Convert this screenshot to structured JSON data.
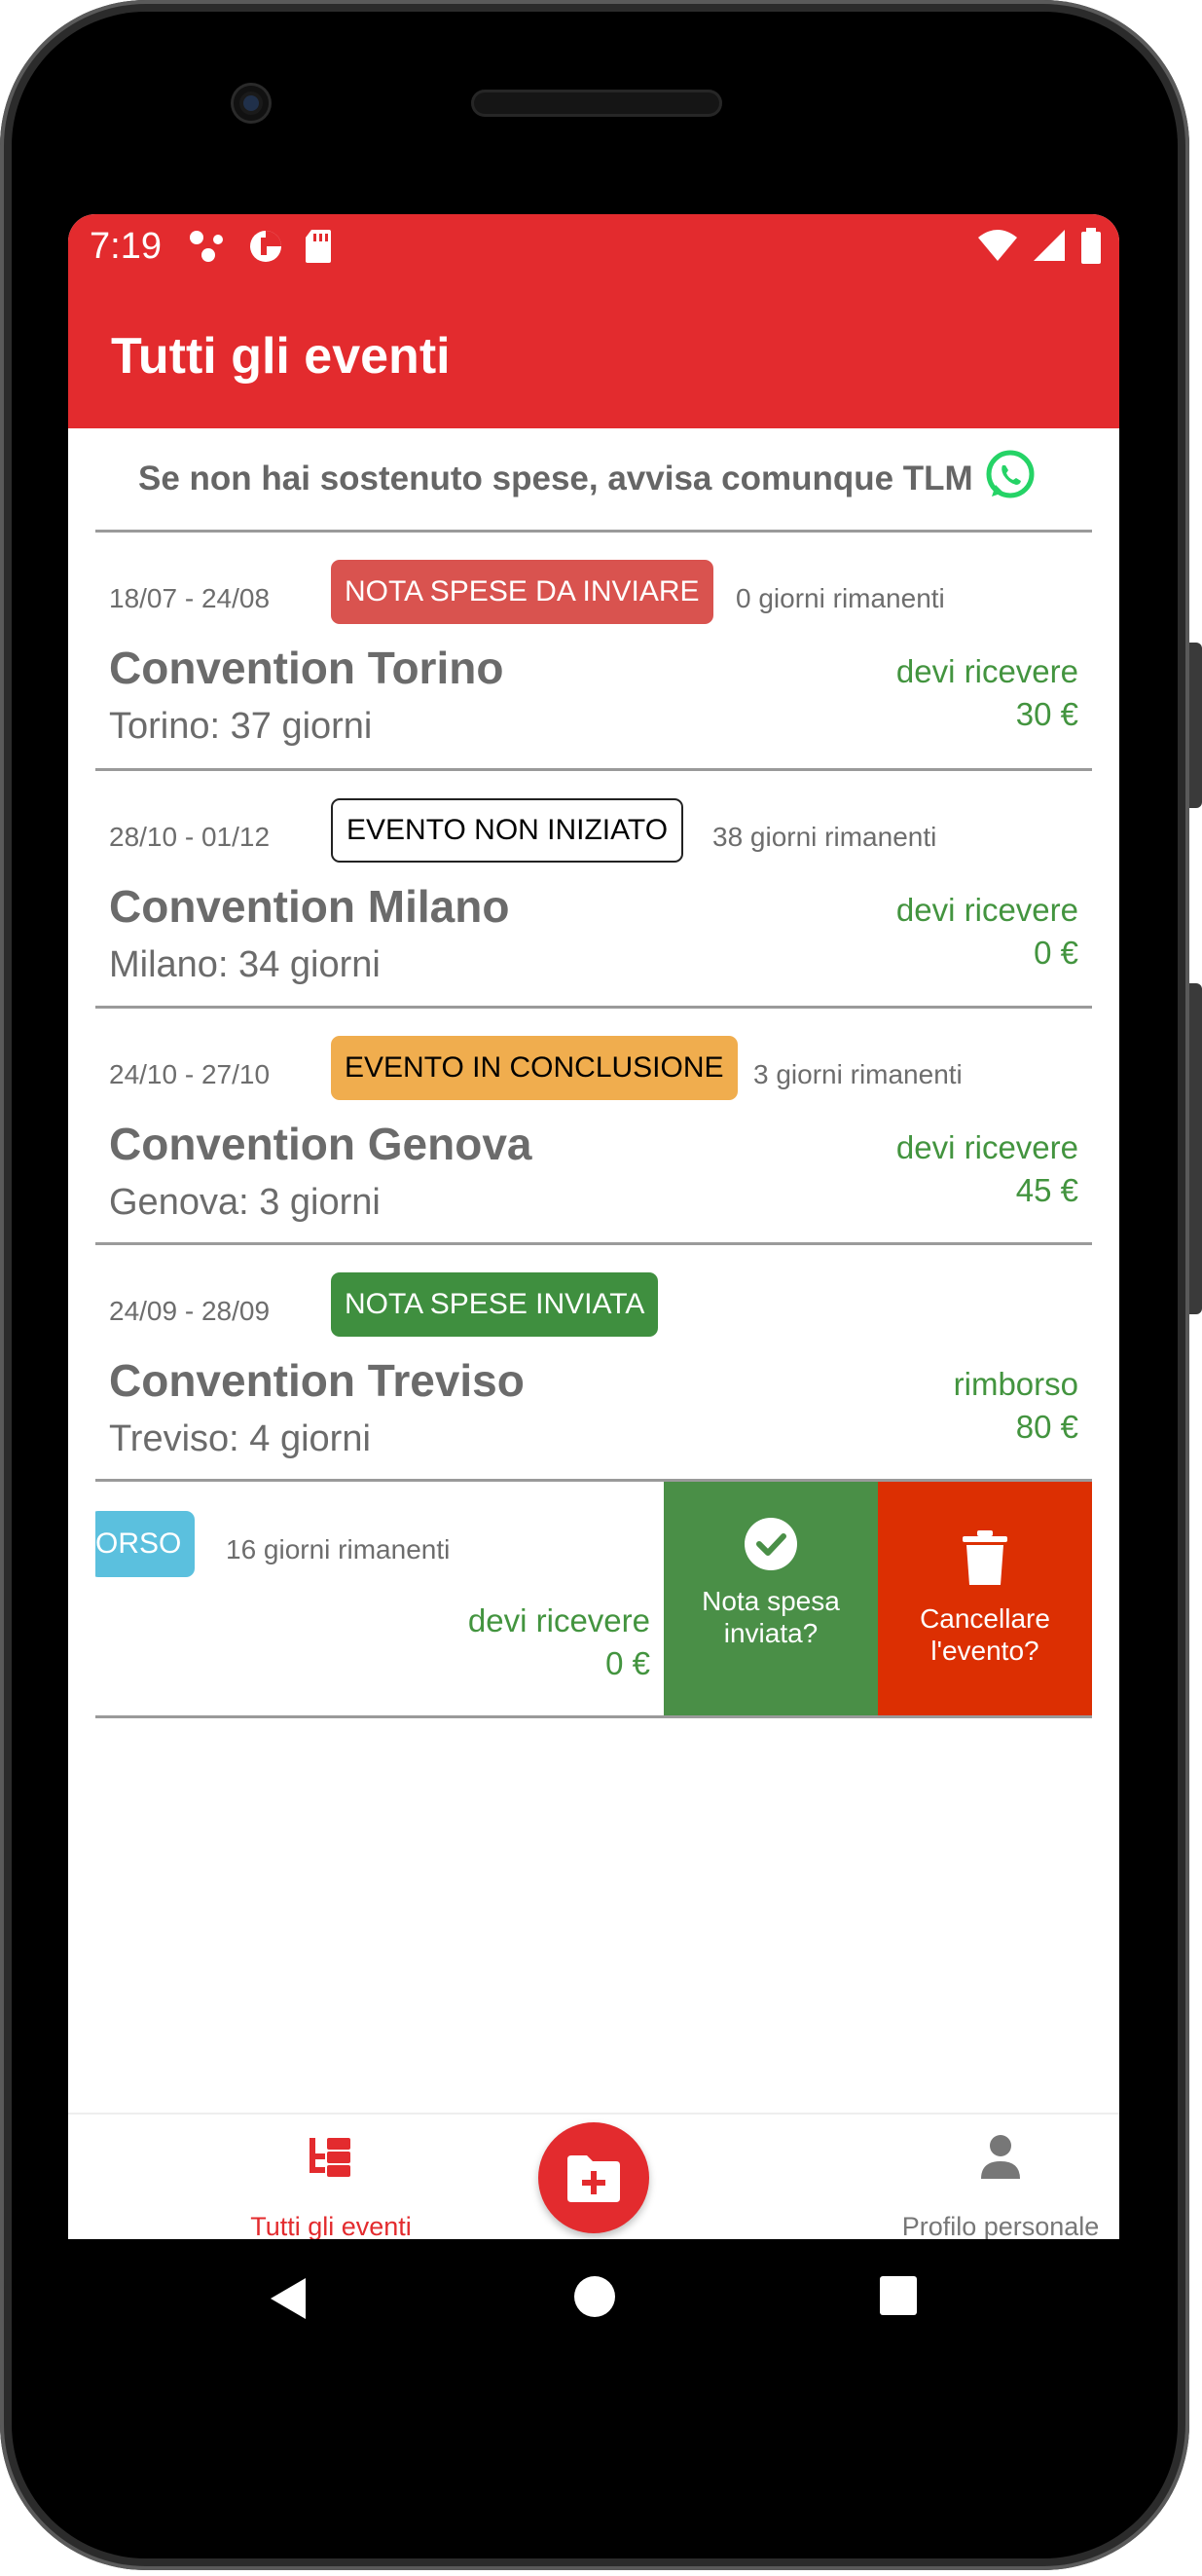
{
  "status_bar": {
    "time": "7:19",
    "left_icons": [
      "notification-dots-icon",
      "data-saver-icon",
      "sd-card-icon"
    ],
    "right_icons": [
      "wifi-icon",
      "signal-icon",
      "battery-icon"
    ]
  },
  "app_bar": {
    "title": "Tutti gli eventi"
  },
  "notice": {
    "text": "Se non hai sostenuto spese, avvisa comunque TLM",
    "icon": "whatsapp-icon"
  },
  "events": [
    {
      "dates": "18/07 - 24/08",
      "badge": "NOTA SPESE DA INVIARE",
      "badge_bg": "#d9534f",
      "badge_fg": "#ffffff",
      "days_left": "0 giorni rimanenti",
      "title": "Convention Torino",
      "subtitle": "Torino: 37 giorni",
      "amount_label": "devi ricevere",
      "amount": "30 €"
    },
    {
      "dates": "28/10 - 01/12",
      "badge": "EVENTO NON INIZIATO",
      "badge_bg": "#ffffff",
      "badge_fg": "#000000",
      "days_left": "38 giorni rimanenti",
      "title": "Convention Milano",
      "subtitle": "Milano: 34 giorni",
      "amount_label": "devi ricevere",
      "amount": "0 €"
    },
    {
      "dates": "24/10 - 27/10",
      "badge": "EVENTO IN CONCLUSIONE",
      "badge_bg": "#f0ad4e",
      "badge_fg": "#000000",
      "days_left": "3 giorni rimanenti",
      "title": "Convention Genova",
      "subtitle": "Genova: 3 giorni",
      "amount_label": "devi ricevere",
      "amount": "45 €"
    },
    {
      "dates": "24/09 - 28/09",
      "badge": "NOTA SPESE INVIATA",
      "badge_bg": "#3f8f3f",
      "badge_fg": "#ffffff",
      "days_left": "",
      "title": "Convention Treviso",
      "subtitle": "Treviso: 4 giorni",
      "amount_label": "rimborso",
      "amount": "80 €"
    }
  ],
  "swiped_event": {
    "badge": "ORSO",
    "badge_bg": "#5bc0de",
    "days_left": "16 giorni rimanenti",
    "amount_label": "devi ricevere",
    "amount": "0 €",
    "actions": [
      {
        "label": "Nota spesa inviata?",
        "icon": "check-circle-icon",
        "color": "#4a8f47"
      },
      {
        "label": "Cancellare l'evento?",
        "icon": "trash-icon",
        "color": "#dc2f02"
      }
    ]
  },
  "bottom_nav": {
    "items": [
      {
        "label": "Tutti gli eventi",
        "icon": "events-tree-icon",
        "active": true
      },
      {
        "label": "Profilo personale",
        "icon": "person-icon",
        "active": false
      }
    ],
    "fab_icon": "folder-add-icon"
  },
  "colors": {
    "primary": "#e32b2e",
    "money": "#43943f",
    "text_muted": "#6b6b6b"
  },
  "system_nav": [
    "back-icon",
    "home-icon",
    "recents-icon"
  ]
}
